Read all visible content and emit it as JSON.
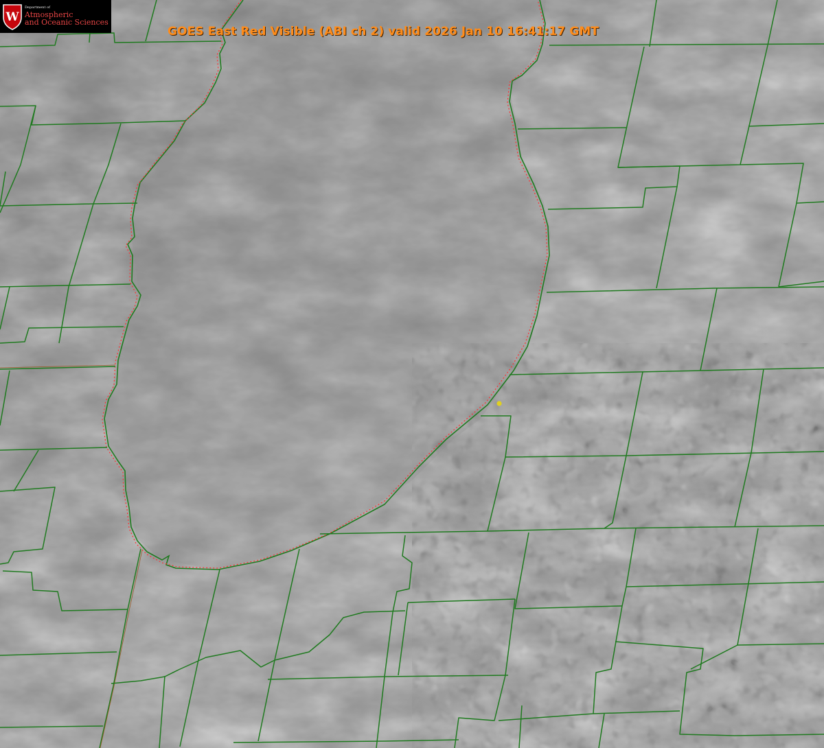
{
  "title": "GOES East Red Visible (ABI ch 2) valid 2026 Jan 10 16:41:17 GMT",
  "logo": {
    "department": "Department of",
    "line1": "Atmospheric",
    "line2": "and Oceanic Sciences",
    "seal_letter": "W",
    "seal_icon": "uw-crest-icon"
  },
  "colors": {
    "boundary": "#1f7a1f",
    "lake_outline": "#ff3030",
    "title": "#ff8c1a",
    "marker": "#e0d020",
    "logo_text": "#e84545"
  }
}
